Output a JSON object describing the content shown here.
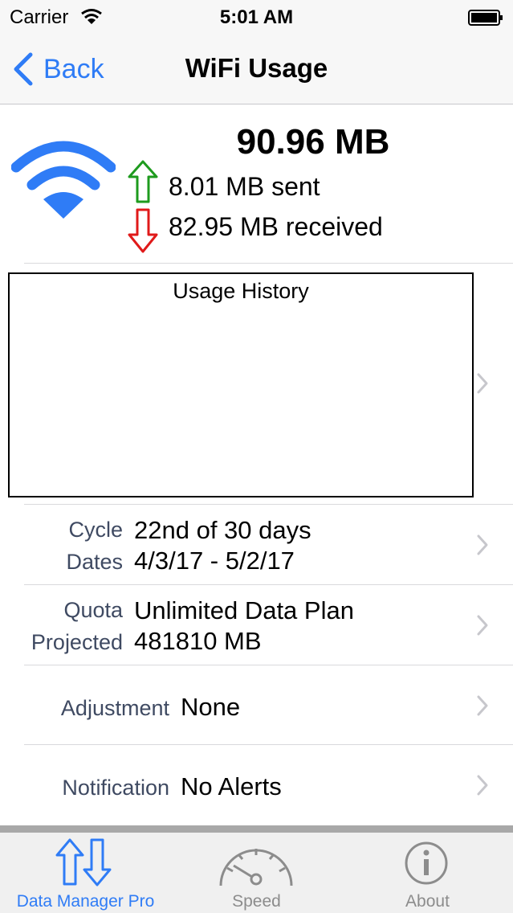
{
  "status": {
    "carrier": "Carrier",
    "time": "5:01 AM"
  },
  "nav": {
    "back_label": "Back",
    "title": "WiFi Usage"
  },
  "summary": {
    "total": "90.96 MB",
    "sent": "8.01 MB sent",
    "received": "82.95 MB received"
  },
  "chart": {
    "title": "Usage History"
  },
  "cycle": {
    "label1": "Cycle",
    "value1": "22nd of 30 days",
    "label2": "Dates",
    "value2": "4/3/17 - 5/2/17"
  },
  "quota": {
    "label1": "Quota",
    "value1": "Unlimited Data Plan",
    "label2": "Projected",
    "value2": "481810 MB"
  },
  "adjustment": {
    "label": "Adjustment",
    "value": "None"
  },
  "notification": {
    "label": "Notification",
    "value": "No Alerts"
  },
  "tabs": [
    {
      "label": "Data Manager Pro",
      "icon": "data-arrows-icon",
      "selected": true
    },
    {
      "label": "Speed",
      "icon": "speedometer-icon",
      "selected": false
    },
    {
      "label": "About",
      "icon": "info-icon",
      "selected": false
    }
  ],
  "colors": {
    "accent": "#2f7cf6",
    "up_arrow": "#1e9b1e",
    "down_arrow": "#e01a1a",
    "label_text": "#3f4a62",
    "tab_inactive": "#8c8c8c"
  }
}
